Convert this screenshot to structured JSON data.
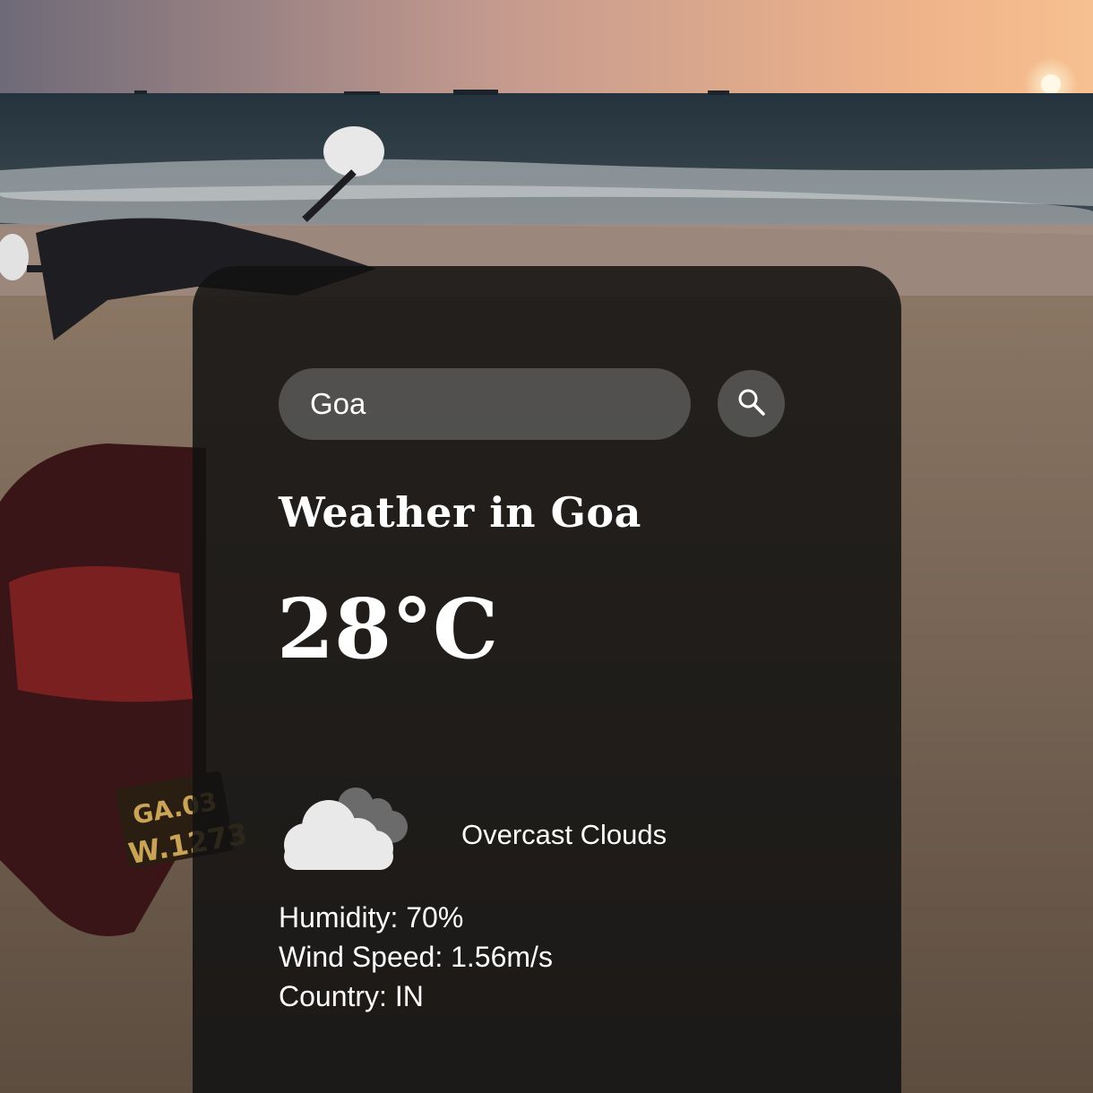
{
  "search": {
    "value": "Goa",
    "icon": "search-icon"
  },
  "weather": {
    "title": "Weather in Goa",
    "temperature": "28°C",
    "condition": "Overcast Clouds",
    "condition_icon": "cloud-icon",
    "humidity": "Humidity: 70%",
    "wind_speed": "Wind Speed: 1.56m/s",
    "country": "Country: IN"
  },
  "background": {
    "description_icon": "beach-scooter-photo",
    "license_plate_line1": "GA.03",
    "license_plate_line2": "W.1273"
  },
  "colors": {
    "card": "#121212",
    "text": "#ffffff",
    "control": "#787878"
  }
}
